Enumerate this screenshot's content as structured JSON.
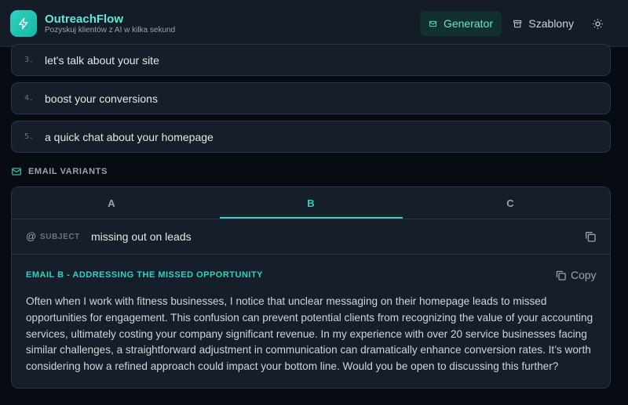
{
  "header": {
    "app_title": "OutreachFlow",
    "app_subtitle": "Pozyskuj klientów z AI w kilka sekund",
    "nav": {
      "generator": "Generator",
      "szablony": "Szablony"
    }
  },
  "subject_lines": [
    {
      "num": "3.",
      "text": "let's talk about your site"
    },
    {
      "num": "4.",
      "text": "boost your conversions"
    },
    {
      "num": "5.",
      "text": "a quick chat about your homepage"
    }
  ],
  "variants": {
    "section_label": "EMAIL VARIANTS",
    "tabs": [
      "A",
      "B",
      "C"
    ],
    "active_tab": "B",
    "subject_key": "SUBJECT",
    "subject_value": "missing out on leads",
    "email_heading": "EMAIL B - ADDRESSING THE MISSED OPPORTUNITY",
    "copy_label": "Copy",
    "body": "Often when I work with fitness businesses, I notice that unclear messaging on their homepage leads to missed opportunities for engagement. This confusion can prevent potential clients from recognizing the value of your accounting services, ultimately costing your company significant revenue. In my experience with over 20 service businesses facing similar challenges, a straightforward adjustment in communication can dramatically enhance conversion rates. It’s worth considering how a refined approach could impact your bottom line. Would you be open to discussing this further?"
  },
  "colors": {
    "accent": "#2dd4bf",
    "background": "#070b14",
    "card": "#151e2a",
    "border": "#2a3646"
  }
}
